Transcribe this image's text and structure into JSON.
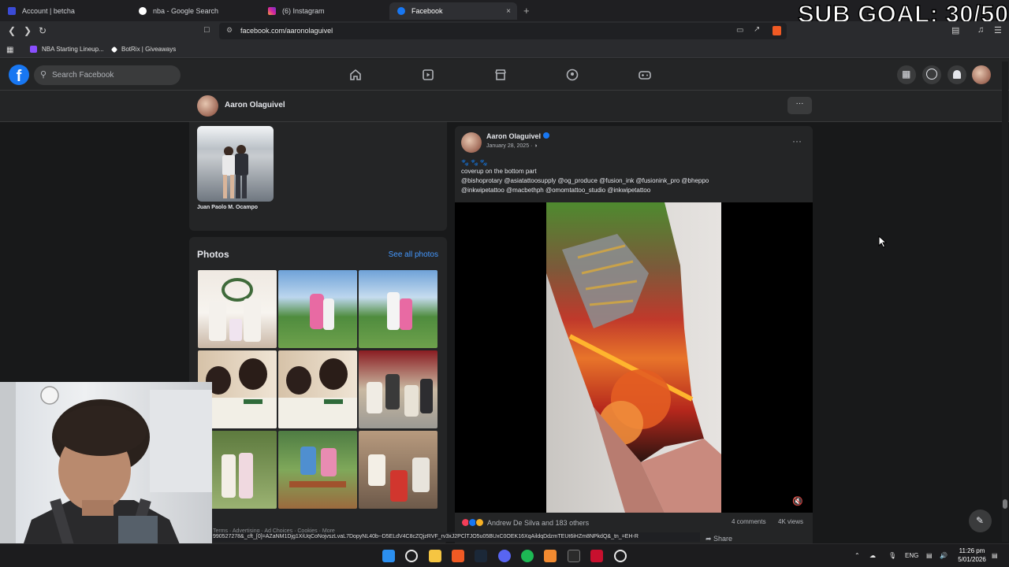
{
  "browser": {
    "tabs": [
      {
        "label": "Account | betcha",
        "color": "#3b4bd6"
      },
      {
        "label": "nba - Google Search",
        "color": "#ffffff"
      },
      {
        "label": "(6) Instagram",
        "color": "#d6249f"
      },
      {
        "label": "Facebook",
        "color": "#1877f2",
        "active": true
      }
    ],
    "new_tab_glyph": "+",
    "close_glyph": "×",
    "url": "facebook.com/aaronolaguivel",
    "bookmarks": [
      {
        "label": "NBA Starting Lineup...",
        "color": "#8a4fff"
      },
      {
        "label": "BotRix | Giveaways",
        "color": "#ffffff"
      }
    ],
    "status_url": "990527278&_cft_[0]=AZaNM1Djg1XiUqCoNojvszLvaL7DopyNL40b--D5ELdV4C8cZQjzRVF_rv3xJ2PClTJO5u05BUxC0OEK16XqAildqDdzmTEUt6iHZm8NPkdQ&_tn_=EH-R"
  },
  "overlay": {
    "sub_goal": "SUB GOAL: 30/50"
  },
  "facebook": {
    "logo": "f",
    "search_placeholder": "Search Facebook",
    "nav_icons": [
      "home-icon",
      "video-icon",
      "marketplace-icon",
      "groups-icon",
      "gaming-icon"
    ],
    "profile_name": "Aaron Olaguivel",
    "more_glyph": "···",
    "friend": {
      "name": "Juan Paolo M. Ocampo"
    },
    "photos": {
      "title": "Photos",
      "see_all": "See all photos",
      "count": 9
    },
    "footer_links": "Terms · Advertising · Ad Choices · Cookies · More",
    "post": {
      "author": "Aaron Olaguivel",
      "date": "January 28, 2025 · ",
      "menu_glyph": "···",
      "emoji_line": "🐾🐾🐾",
      "lines": [
        "coverup on the bottom part",
        "@bishoprotary @asiatattoosupply @og_produce @fusion_ink @fusionink_pro @bheppo",
        "@inkwipetattoo @macbethph @omomtattoo_studio @inkwipetattoo"
      ],
      "reactions_text": "Andrew De Silva and 183 others",
      "comments": "4 comments",
      "views": "4K views",
      "share": "Share",
      "mute_glyph": "🔇"
    }
  },
  "taskbar": {
    "lang": "ENG",
    "time": "11:26 pm",
    "date": "5/01/2026",
    "icons": [
      "windows-start",
      "search",
      "file-explorer",
      "brave-browser",
      "steam",
      "discord",
      "spotify",
      "app-orange",
      "terminal",
      "x-app",
      "app-circle"
    ]
  },
  "colors": {
    "fb_bg": "#18191a",
    "fb_card": "#242526",
    "fb_blue": "#1877f2",
    "link": "#4599ff"
  }
}
